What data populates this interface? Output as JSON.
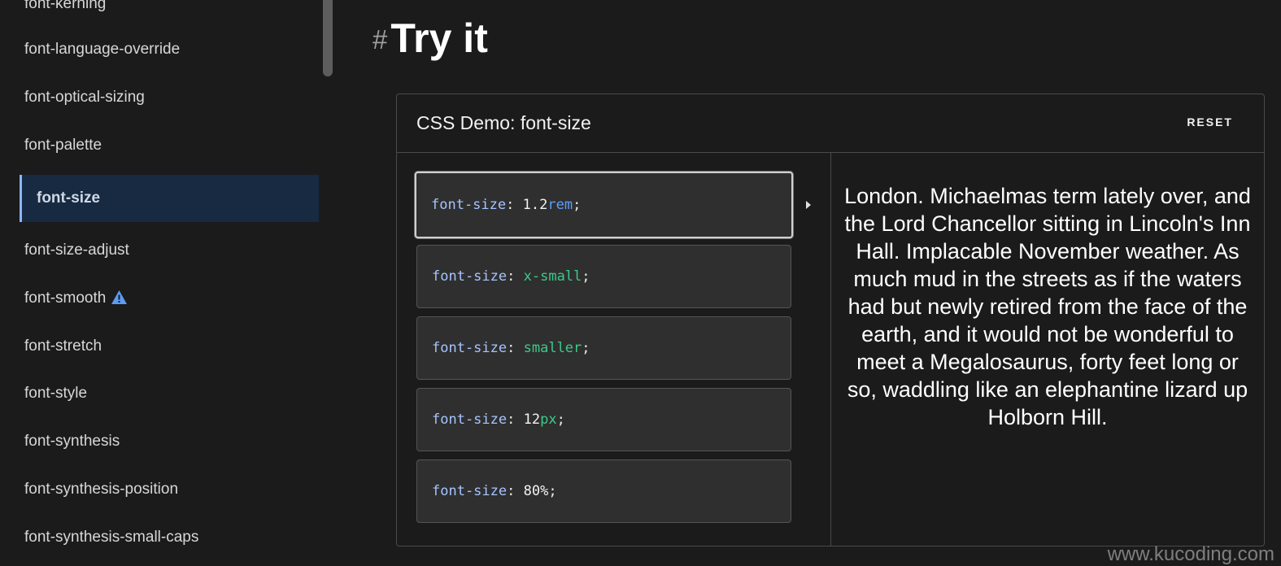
{
  "sidebar": {
    "items": [
      {
        "label": "font-kerning"
      },
      {
        "label": "font-language-override"
      },
      {
        "label": "font-optical-sizing"
      },
      {
        "label": "font-palette"
      },
      {
        "label": "font-size"
      },
      {
        "label": "font-size-adjust"
      },
      {
        "label": "font-smooth"
      },
      {
        "label": "font-stretch"
      },
      {
        "label": "font-style"
      },
      {
        "label": "font-synthesis"
      },
      {
        "label": "font-synthesis-position"
      },
      {
        "label": "font-synthesis-small-caps"
      }
    ],
    "active": "font-size",
    "warning_icon_item": "font-smooth"
  },
  "heading": {
    "hash": "#",
    "title": "Try it"
  },
  "demo": {
    "title": "CSS Demo: font-size",
    "reset_label": "RESET",
    "options": [
      {
        "prop": "font-size",
        "colon": ":",
        "value": "1.2",
        "unit": "rem",
        "semi": ";"
      },
      {
        "prop": "font-size",
        "colon": ":",
        "value": "x-small",
        "semi": ";"
      },
      {
        "prop": "font-size",
        "colon": ":",
        "value": "smaller",
        "semi": ";"
      },
      {
        "prop": "font-size",
        "colon": ":",
        "value": "12",
        "unit": "px",
        "semi": ";"
      },
      {
        "prop": "font-size",
        "colon": ":",
        "value": "80%",
        "semi": ";"
      }
    ],
    "selected_index": 0,
    "output_text": "London. Michaelmas term lately over, and the Lord Chancellor sitting in Lincoln's Inn Hall. Implacable November weather. As much mud in the streets as if the waters had but newly retired from the face of the earth, and it would not be wonderful to meet a Megalosaurus, forty feet long or so, waddling like an elephantine lizard up Holborn Hill."
  },
  "watermark": "www.kucoding.com",
  "colors": {
    "background": "#1b1b1b",
    "active_item_bg": "#172a42",
    "active_item_border": "#8cb4ff",
    "property": "#a6c4ff",
    "unit_blue": "#5ba0ff",
    "keyword_green": "#3dc98a",
    "warning_icon": "#5b9bf5"
  }
}
